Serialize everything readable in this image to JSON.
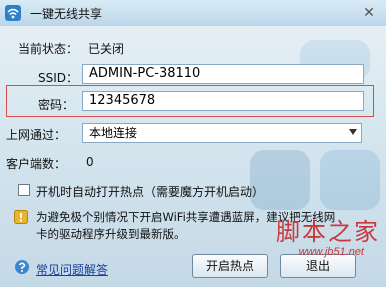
{
  "window": {
    "title": "一键无线共享",
    "close_symbol": "✕"
  },
  "status": {
    "label": "当前状态：",
    "value": "已关闭"
  },
  "ssid": {
    "label": "SSID：",
    "value": "ADMIN-PC-38110"
  },
  "password": {
    "label": "密码：",
    "value": "12345678"
  },
  "network": {
    "label": "上网通过：",
    "selected": "本地连接"
  },
  "clients": {
    "label": "客户端数：",
    "value": "0"
  },
  "autostart": {
    "label": "开机时自动打开热点（需要魔方开机启动）",
    "checked": false
  },
  "info": {
    "text": "为避免极个别情况下开启WiFi共享遭遇蓝屏，建议把无线网卡的驱动程序升级到最新版。"
  },
  "help": {
    "link": "常见问题解答"
  },
  "buttons": {
    "start": "开启热点",
    "exit": "退出"
  },
  "watermark": {
    "text": "脚本之家",
    "url": "www.jb51.net"
  },
  "colors": {
    "highlight_border": "#d54d4d",
    "link": "#1a3fa0",
    "watermark": "#c8393e"
  }
}
